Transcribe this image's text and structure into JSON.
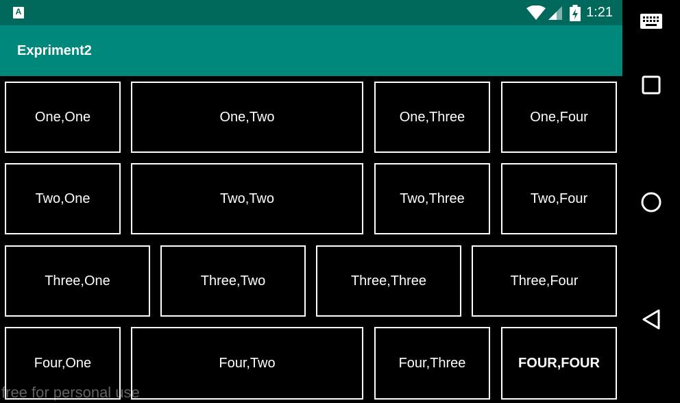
{
  "status_bar": {
    "notification_icon": "app-notification-icon",
    "notification_glyph": "A",
    "time": "1:21",
    "icons": [
      "wifi-icon",
      "cell-signal-icon",
      "battery-charging-icon"
    ]
  },
  "toolbar": {
    "title": "Expriment2"
  },
  "grid": {
    "cells": [
      {
        "label": "One,One"
      },
      {
        "label": "One,Two"
      },
      {
        "label": "One,Three"
      },
      {
        "label": "One,Four"
      },
      {
        "label": "Two,One"
      },
      {
        "label": "Two,Two"
      },
      {
        "label": "Two,Three"
      },
      {
        "label": "Two,Four"
      },
      {
        "label": "Three,One"
      },
      {
        "label": "Three,Two"
      },
      {
        "label": "Three,Three"
      },
      {
        "label": "Three,Four"
      },
      {
        "label": "Four,One"
      },
      {
        "label": "Four,Two"
      },
      {
        "label": "Four,Three"
      },
      {
        "label": "FOUR,FOUR"
      }
    ]
  },
  "nav_bar": {
    "buttons": [
      "keyboard-icon",
      "recents-square-icon",
      "home-circle-icon",
      "back-triangle-icon"
    ]
  },
  "watermark": "free for personal use",
  "colors": {
    "status_bar": "#00695c",
    "toolbar": "#00897b",
    "background": "#000000",
    "cell_border": "#ffffff"
  }
}
